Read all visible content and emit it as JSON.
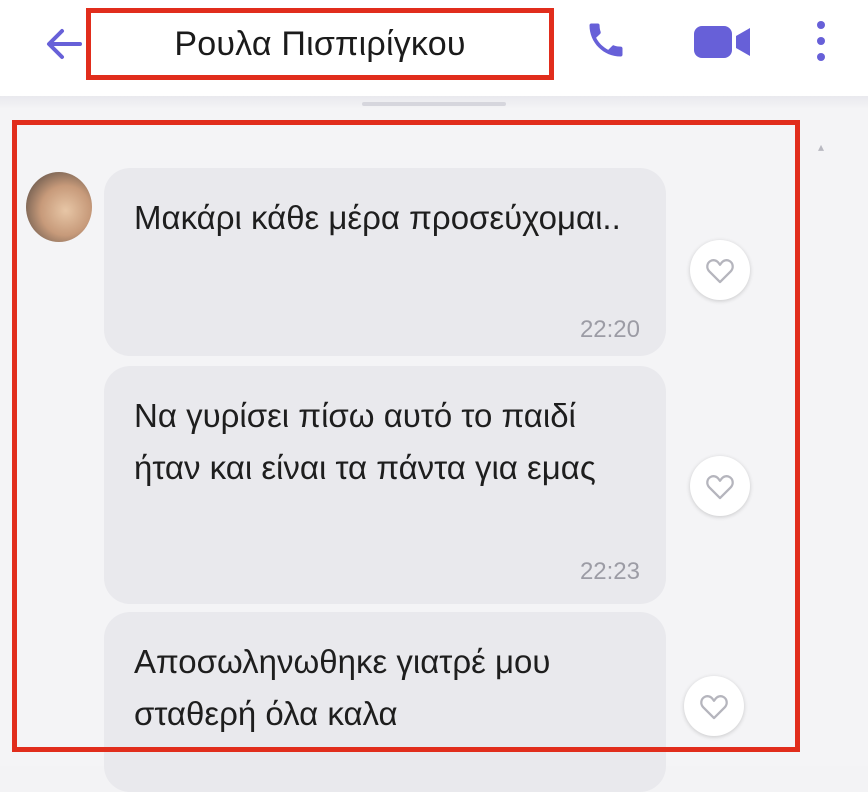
{
  "header": {
    "contact_name": "Ρουλα Πισπιρίγκου",
    "icons": {
      "back": "arrow-left-icon",
      "call": "phone-icon",
      "video": "video-camera-icon",
      "more": "more-vertical-icon"
    }
  },
  "messages": [
    {
      "text": "Μακάρι κάθε μέρα προσεύχομαι..",
      "time": "22:20"
    },
    {
      "text": "Να γυρίσει πίσω αυτό το παιδί ήταν και είναι τα πάντα για εμας",
      "time": "22:23"
    },
    {
      "text": "Αποσωληνωθηκε γιατρέ μου σταθερή όλα καλα",
      "time": ""
    }
  ],
  "colors": {
    "accent": "#6760d8",
    "highlight": "#e12d1c",
    "bubble": "#e9e9ed"
  }
}
